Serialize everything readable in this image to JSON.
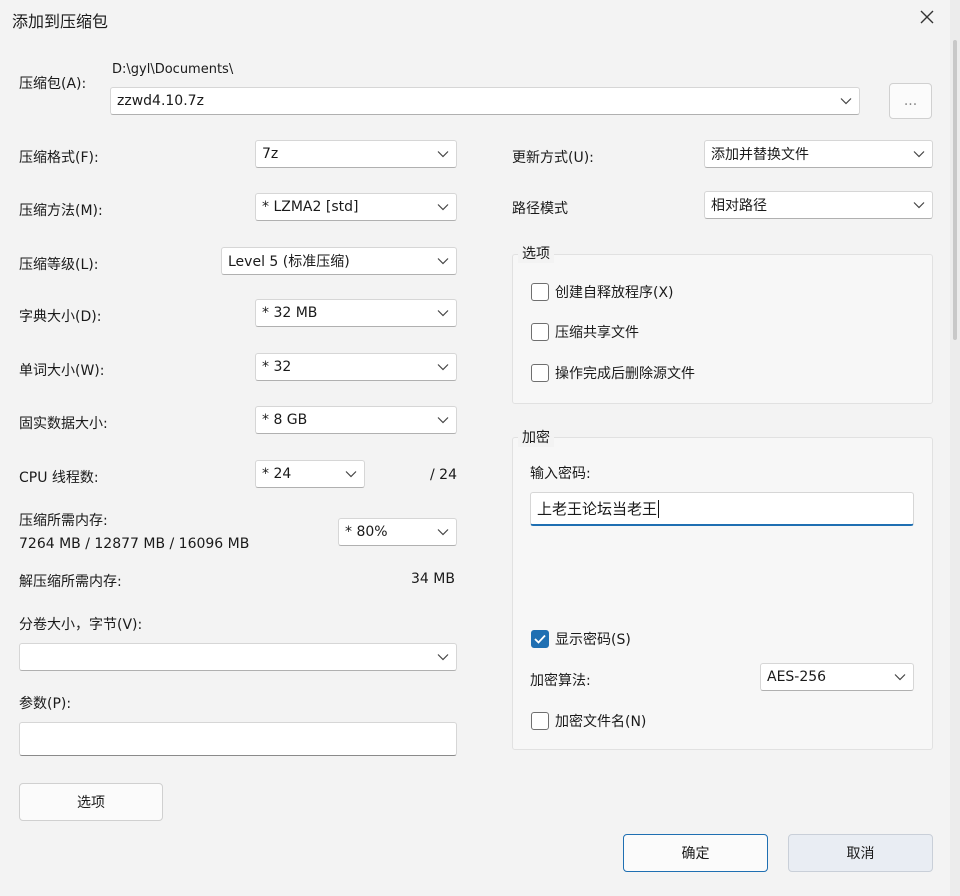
{
  "window": {
    "title": "添加到压缩包"
  },
  "archive": {
    "label": "压缩包(A):",
    "path": "D:\\gyl\\Documents\\",
    "filename": "zzwd4.10.7z",
    "browse_label": "..."
  },
  "left": {
    "format_label": "压缩格式(F):",
    "format_value": "7z",
    "method_label": "压缩方法(M):",
    "method_value": "* LZMA2 [std]",
    "level_label": "压缩等级(L):",
    "level_value": "Level 5 (标准压缩)",
    "dict_label": "字典大小(D):",
    "dict_value": "* 32 MB",
    "word_label": "单词大小(W):",
    "word_value": "* 32",
    "solid_label": "固实数据大小:",
    "solid_value": "* 8 GB",
    "threads_label": "CPU 线程数:",
    "threads_value": "* 24",
    "threads_max": "/ 24",
    "mem_label": "压缩所需内存:",
    "mem_detail": "7264 MB / 12877 MB / 16096 MB",
    "mem_value": "* 80%",
    "decomp_label": "解压缩所需内存:",
    "decomp_value": "34 MB",
    "volume_label": "分卷大小，字节(V):",
    "volume_value": "",
    "params_label": "参数(P):",
    "params_value": "",
    "options_button": "选项"
  },
  "right": {
    "update_label": "更新方式(U):",
    "update_value": "添加并替换文件",
    "path_label": "路径模式",
    "path_value": "相对路径",
    "options_group": "选项",
    "opt_sfx": "创建自释放程序(X)",
    "opt_shared": "压缩共享文件",
    "opt_delete": "操作完成后删除源文件",
    "encrypt_group": "加密",
    "password_label": "输入密码:",
    "password_value": "上老王论坛当老王",
    "show_password": "显示密码(S)",
    "show_password_checked": true,
    "algo_label": "加密算法:",
    "algo_value": "AES-256",
    "encrypt_names": "加密文件名(N)"
  },
  "footer": {
    "ok": "确定",
    "cancel": "取消"
  },
  "colors": {
    "accent": "#1f6fb2",
    "background": "#f3f3f3"
  }
}
